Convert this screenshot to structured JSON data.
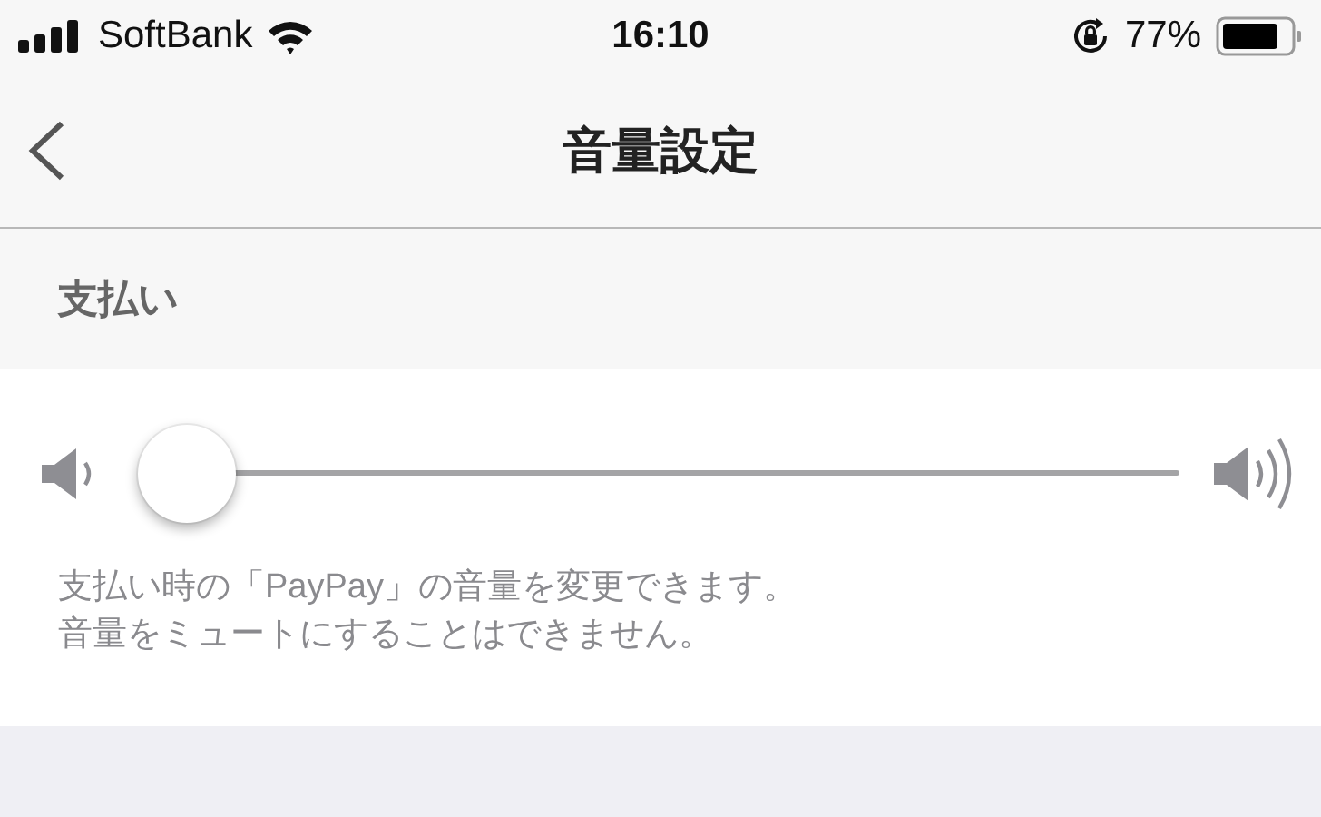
{
  "status_bar": {
    "carrier": "SoftBank",
    "time": "16:10",
    "battery_percent": "77%"
  },
  "nav_bar": {
    "title": "音量設定"
  },
  "section": {
    "header": "支払い",
    "slider": {
      "level": 0
    },
    "description": [
      "支払い時の「PayPay」の音量を変更できます。",
      "音量をミュートにすることはできません。"
    ]
  }
}
